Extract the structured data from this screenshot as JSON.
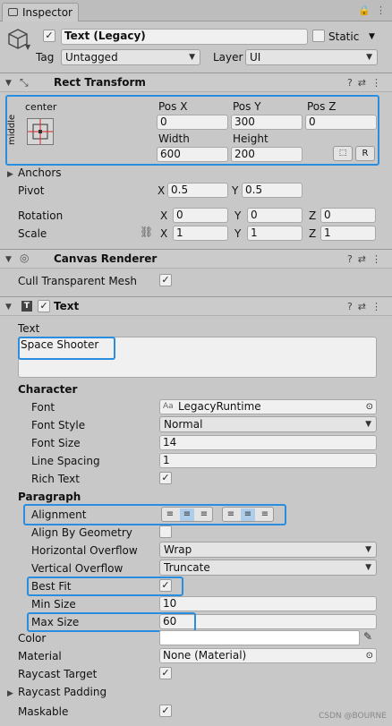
{
  "tab": {
    "title": "Inspector"
  },
  "header": {
    "name": "Text (Legacy)",
    "static_label": "Static",
    "tag_label": "Tag",
    "tag_value": "Untagged",
    "layer_label": "Layer",
    "layer_value": "UI"
  },
  "rect": {
    "title": "Rect Transform",
    "anchor_h": "center",
    "anchor_v": "middle",
    "posx_label": "Pos X",
    "posy_label": "Pos Y",
    "posz_label": "Pos Z",
    "posx": "0",
    "posy": "300",
    "posz": "0",
    "width_label": "Width",
    "height_label": "Height",
    "width": "600",
    "height": "200",
    "r_label": "R",
    "anchors": "Anchors",
    "pivot": "Pivot",
    "pivot_x": "0.5",
    "pivot_y": "0.5",
    "rotation": "Rotation",
    "scale": "Scale",
    "x": "X",
    "y": "Y",
    "z": "Z",
    "rot_x": "0",
    "rot_y": "0",
    "rot_z": "0",
    "scale_x": "1",
    "scale_y": "1",
    "scale_z": "1"
  },
  "canvas": {
    "title": "Canvas Renderer",
    "cull": "Cull Transparent Mesh"
  },
  "text": {
    "title": "Text",
    "text_label": "Text",
    "text_value": "Space Shooter",
    "character": "Character",
    "font": "Font",
    "font_value": "LegacyRuntime",
    "font_style": "Font Style",
    "font_style_value": "Normal",
    "font_size": "Font Size",
    "font_size_value": "14",
    "line_spacing": "Line Spacing",
    "line_spacing_value": "1",
    "rich_text": "Rich Text",
    "paragraph": "Paragraph",
    "alignment": "Alignment",
    "align_geom": "Align By Geometry",
    "h_overflow": "Horizontal Overflow",
    "h_overflow_value": "Wrap",
    "v_overflow": "Vertical Overflow",
    "v_overflow_value": "Truncate",
    "best_fit": "Best Fit",
    "min_size": "Min Size",
    "min_size_value": "10",
    "max_size": "Max Size",
    "max_size_value": "60",
    "color": "Color",
    "material": "Material",
    "material_value": "None (Material)",
    "raycast_target": "Raycast Target",
    "raycast_padding": "Raycast Padding",
    "maskable": "Maskable"
  },
  "watermark": "CSDN @BOURNE",
  "colors": {
    "highlight": "#2a8ee0",
    "color_field": "#ffffff"
  }
}
